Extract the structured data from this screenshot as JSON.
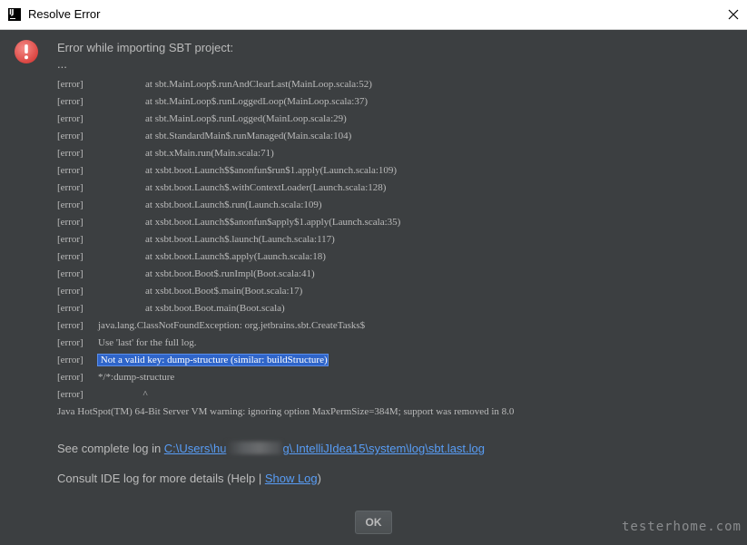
{
  "window": {
    "title": "Resolve Error",
    "app_icon_text": "IJ"
  },
  "dialog": {
    "heading": "Error while importing SBT project:",
    "ellipsis": "...",
    "log_lines": [
      {
        "tag": "[error]",
        "text": "at sbt.MainLoop$.runAndClearLast(MainLoop.scala:52)",
        "indent": true
      },
      {
        "tag": "[error]",
        "text": "at sbt.MainLoop$.runLoggedLoop(MainLoop.scala:37)",
        "indent": true
      },
      {
        "tag": "[error]",
        "text": "at sbt.MainLoop$.runLogged(MainLoop.scala:29)",
        "indent": true
      },
      {
        "tag": "[error]",
        "text": "at sbt.StandardMain$.runManaged(Main.scala:104)",
        "indent": true
      },
      {
        "tag": "[error]",
        "text": "at sbt.xMain.run(Main.scala:71)",
        "indent": true
      },
      {
        "tag": "[error]",
        "text": "at xsbt.boot.Launch$$anonfun$run$1.apply(Launch.scala:109)",
        "indent": true
      },
      {
        "tag": "[error]",
        "text": "at xsbt.boot.Launch$.withContextLoader(Launch.scala:128)",
        "indent": true
      },
      {
        "tag": "[error]",
        "text": "at xsbt.boot.Launch$.run(Launch.scala:109)",
        "indent": true
      },
      {
        "tag": "[error]",
        "text": "at xsbt.boot.Launch$$anonfun$apply$1.apply(Launch.scala:35)",
        "indent": true
      },
      {
        "tag": "[error]",
        "text": "at xsbt.boot.Launch$.launch(Launch.scala:117)",
        "indent": true
      },
      {
        "tag": "[error]",
        "text": "at xsbt.boot.Launch$.apply(Launch.scala:18)",
        "indent": true
      },
      {
        "tag": "[error]",
        "text": "at xsbt.boot.Boot$.runImpl(Boot.scala:41)",
        "indent": true
      },
      {
        "tag": "[error]",
        "text": "at xsbt.boot.Boot$.main(Boot.scala:17)",
        "indent": true
      },
      {
        "tag": "[error]",
        "text": "at xsbt.boot.Boot.main(Boot.scala)",
        "indent": true
      },
      {
        "tag": "[error]",
        "text": "java.lang.ClassNotFoundException: org.jetbrains.sbt.CreateTasks$",
        "indent": false
      },
      {
        "tag": "[error]",
        "text": "Use 'last' for the full log.",
        "indent": false
      },
      {
        "tag": "[error]",
        "text": " Not a valid key: dump-structure (similar: buildStructure)",
        "indent": false,
        "highlighted": true
      },
      {
        "tag": "[error]",
        "text": "*/*:dump-structure",
        "indent": false
      },
      {
        "tag": "[error]",
        "text": "                  ^",
        "indent": false
      }
    ],
    "jvm_warning": "Java HotSpot(TM) 64-Bit Server VM warning: ignoring option MaxPermSize=384M; support was removed in 8.0",
    "see_log_prefix": "See complete log in ",
    "log_path_start": "C:\\Users\\hu",
    "log_path_end": "g\\.IntelliJIdea15\\system\\log\\sbt.last.log",
    "consult_prefix": "Consult IDE log for more details (Help | ",
    "show_log_label": "Show Log",
    "consult_suffix": ")",
    "ok_label": "OK"
  },
  "watermark": "testerhome.com",
  "colors": {
    "background": "#3c3f41",
    "text": "#bbbbbb",
    "link": "#589df6",
    "selection": "#2f65ca",
    "error_red": "#e0524f"
  }
}
